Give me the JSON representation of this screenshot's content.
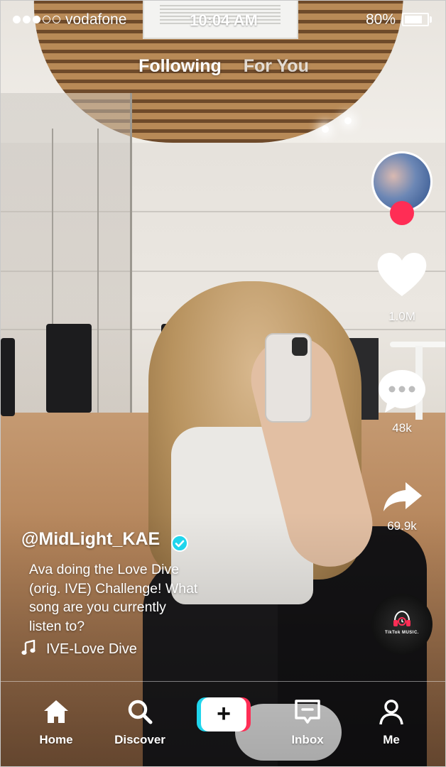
{
  "status_bar": {
    "carrier": "vodafone",
    "time": "10:04 AM",
    "battery_percent": "80%",
    "battery_level": 0.8,
    "signal_bars_filled": 3,
    "signal_bars_total": 5
  },
  "top_tabs": {
    "following": "Following",
    "for_you": "For You",
    "active": "Following"
  },
  "right_rail": {
    "avatar_icon": "creator-avatar",
    "follow_icon": "plus-follow-icon",
    "like_icon": "heart-icon",
    "likes": "1.0M",
    "comment_icon": "comment-bubble-icon",
    "comments": "48k",
    "share_icon": "share-arrow-icon",
    "shares": "69.9k",
    "music_disc_icon": "music-disc-icon",
    "music_disc_label": "TikTok MUSIC."
  },
  "post": {
    "username": "@MidLight_KAE",
    "verified_icon": "verified-check-icon",
    "caption_lines": [
      "Ava doing the Love Dive",
      "(orig. IVE) Challenge! What",
      "song are you currently",
      "listen to?"
    ],
    "music_icon": "music-note-icon",
    "music_title": "IVE-Love Dive"
  },
  "nav": {
    "home": "Home",
    "discover": "Discover",
    "create_icon": "plus-create-icon",
    "inbox": "Inbox",
    "me": "Me"
  },
  "colors": {
    "accent_pink": "#ff2d55",
    "accent_cyan": "#20d5ec",
    "text": "#ffffff"
  }
}
